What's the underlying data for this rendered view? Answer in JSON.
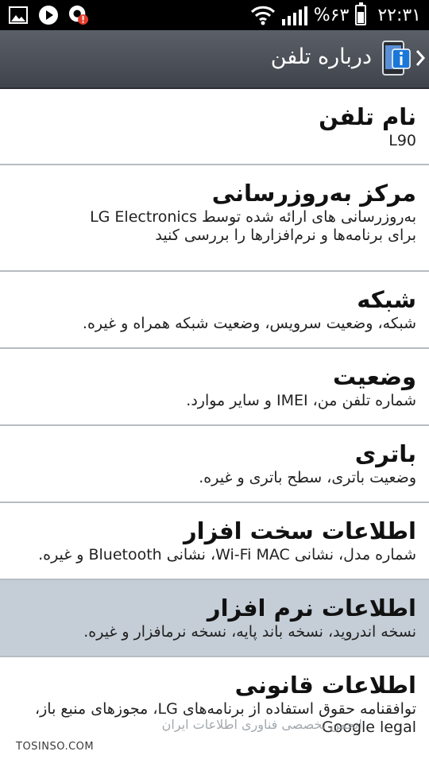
{
  "status_bar": {
    "battery_percent": "%۶۳",
    "time": "۲۲:۳۱",
    "battery_level": 0.63,
    "icons": [
      "image-icon",
      "play-icon",
      "alert-icon",
      "wifi-icon",
      "signal-icon",
      "battery-icon"
    ]
  },
  "action_bar": {
    "title": "درباره تلفن",
    "icon": "phone-info-icon",
    "back_icon": "chevron-right-icon"
  },
  "items": [
    {
      "title": "نام تلفن",
      "subtitle": "L90"
    },
    {
      "title": "مرکز به‌روزرسانی",
      "subtitle": "به‌روزرسانی های ارائه شده توسط LG Electronics برای برنامه‌ها و نرم‌افزارها را بررسی کنید"
    },
    {
      "title": "شبکه",
      "subtitle": "شبکه، وضعیت سرویس، وضعیت شبکه همراه و غیره."
    },
    {
      "title": "وضعیت",
      "subtitle": "شماره تلفن من، IMEI و سایر موارد."
    },
    {
      "title": "باتری",
      "subtitle": "وضعیت باتری، سطح باتری و غیره."
    },
    {
      "title": "اطلاعات سخت افزار",
      "subtitle": "شماره مدل، نشانی Wi-Fi MAC، نشانی Bluetooth و غیره."
    },
    {
      "title": "اطلاعات نرم افزار",
      "subtitle": "نسخه اندروید، نسخه باند پایه، نسخه نرمافزار و غیره."
    },
    {
      "title": "اطلاعات قانونی",
      "subtitle": "توافقنامه حقوق استفاده از برنامه‌های LG، مجوزهای منبع باز، Google legal"
    }
  ],
  "watermark": {
    "site": "TOSINSO.COM",
    "overlay": "انجمن تخصصی فناوری اطلاعات ایران"
  },
  "colors": {
    "status_bar": "#000000",
    "action_bar": "#4a4f56",
    "selected_row": "#c5ced7",
    "divider": "#b7bcc2"
  }
}
